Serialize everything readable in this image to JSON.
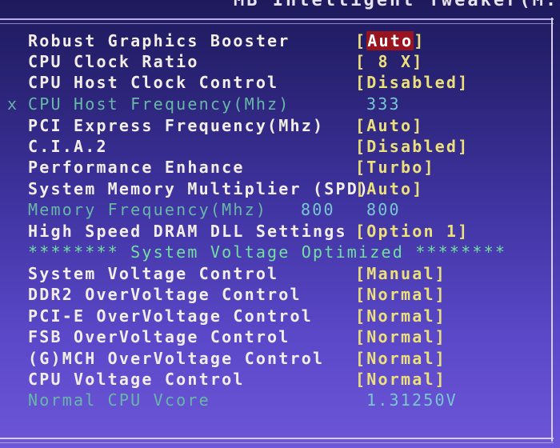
{
  "header": {
    "title": "MB Intelligent Tweaker(M.I.T.)"
  },
  "colors": {
    "label": "#f2eee6",
    "value": "#ece07a",
    "selected_bg": "#9a1420",
    "disabled_label": "#68b8a8",
    "info_value": "#78c8d0",
    "section_header": "#72e0a0"
  },
  "settings": [
    {
      "label": "Robust Graphics Booster",
      "value_open": "[",
      "value": "Auto",
      "value_close": "]",
      "selected": true
    },
    {
      "label": "CPU Clock Ratio",
      "value_full": "[ 8 X]"
    },
    {
      "label": "CPU Host Clock Control",
      "value_full": "[Disabled]"
    },
    {
      "marker": "x",
      "label": "CPU Host Frequency(Mhz)",
      "value_full": "333",
      "disabled": true
    },
    {
      "label": "PCI Express Frequency(Mhz)",
      "value_full": "[Auto]"
    },
    {
      "label": "C.I.A.2",
      "value_full": "[Disabled]"
    },
    {
      "label": "Performance Enhance",
      "value_full": "[Turbo]"
    },
    {
      "label": "System Memory Multiplier (SPD)",
      "value_full": "[Auto]"
    },
    {
      "label": "Memory Frequency(Mhz)",
      "mid_value": "800",
      "value_full": "800",
      "disabled": true
    },
    {
      "label": "High Speed DRAM DLL Settings",
      "value_full": "[Option 1]"
    },
    {
      "section": "******** System Voltage Optimized ********"
    },
    {
      "label": "System Voltage Control",
      "value_full": "[Manual]"
    },
    {
      "label": "DDR2 OverVoltage Control",
      "value_full": "[Normal]"
    },
    {
      "label": "PCI-E OverVoltage Control",
      "value_full": "[Normal]"
    },
    {
      "label": "FSB OverVoltage Control",
      "value_full": "[Normal]"
    },
    {
      "label": "(G)MCH OverVoltage Control",
      "value_full": "[Normal]"
    },
    {
      "label": "CPU Voltage Control",
      "value_full": "[Normal]"
    },
    {
      "label": "Normal CPU Vcore",
      "value_full": "1.31250V",
      "disabled": true
    }
  ]
}
